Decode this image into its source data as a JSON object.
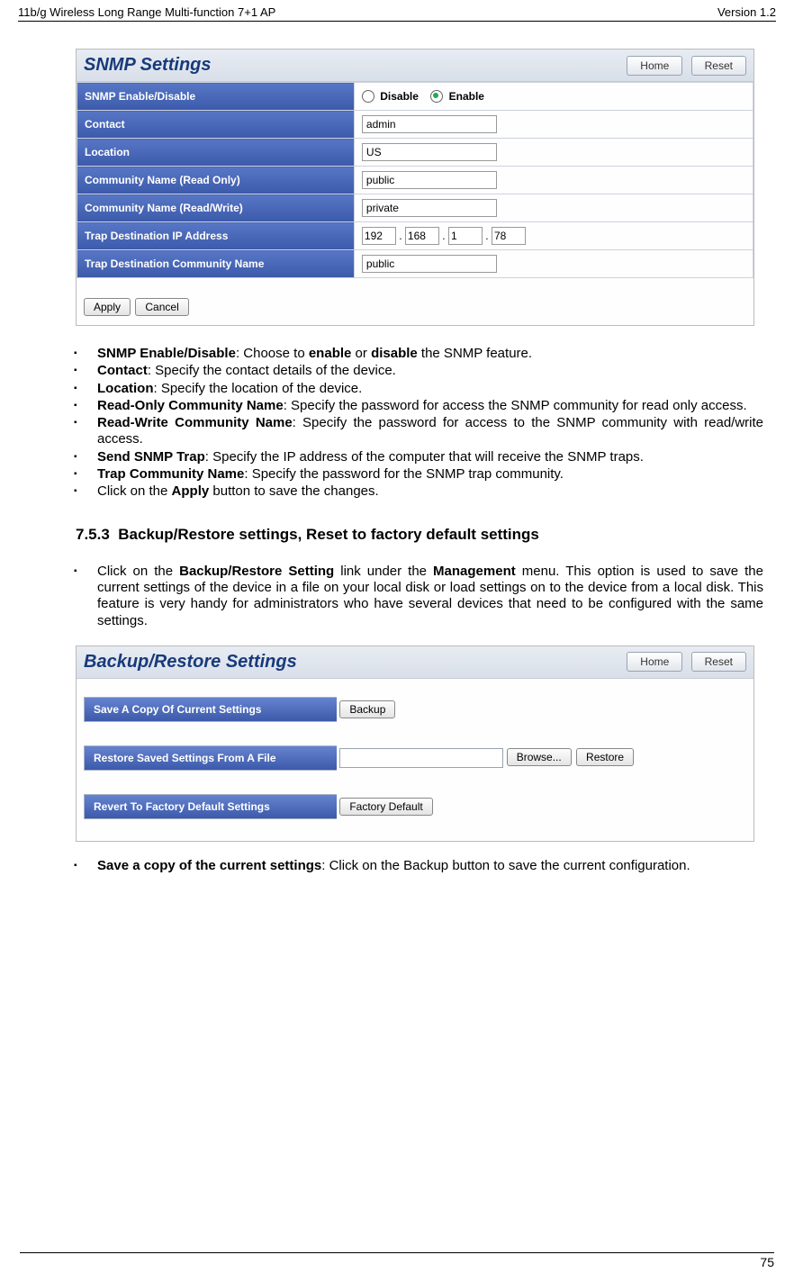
{
  "header": {
    "left": "11b/g Wireless Long Range Multi-function 7+1 AP",
    "right": "Version 1.2"
  },
  "snmp": {
    "title": "SNMP Settings",
    "home": "Home",
    "reset": "Reset",
    "rows": {
      "enable_label": "SNMP Enable/Disable",
      "disable": "Disable",
      "enable": "Enable",
      "contact_label": "Contact",
      "contact_val": "admin",
      "location_label": "Location",
      "location_val": "US",
      "ro_label": "Community Name (Read Only)",
      "ro_val": "public",
      "rw_label": "Community Name (Read/Write)",
      "rw_val": "private",
      "trap_ip_label": "Trap Destination IP Address",
      "ip1": "192",
      "ip2": "168",
      "ip3": "1",
      "ip4": "78",
      "trap_comm_label": "Trap Destination Community Name",
      "trap_comm_val": "public"
    },
    "apply": "Apply",
    "cancel": "Cancel"
  },
  "bullets1": {
    "b1a": "SNMP Enable/Disable",
    "b1b": ": Choose to ",
    "b1c": "enable",
    "b1d": " or ",
    "b1e": "disable",
    "b1f": " the SNMP feature.",
    "b2a": "Contact",
    "b2b": ": Specify the contact details of the device.",
    "b3a": "Location",
    "b3b": ": Specify the location of the device.",
    "b4a": "Read-Only Community Name",
    "b4b": ": Specify the password for access the SNMP community for read only access.",
    "b5a": "Read-Write Community Name",
    "b5b": ": Specify the password for access to the SNMP community with read/write access.",
    "b6a": "Send SNMP Trap",
    "b6b": ": Specify the IP address of the computer that will receive the SNMP traps.",
    "b7a": "Trap Community Name",
    "b7b": ": Specify the password for the SNMP trap community.",
    "b8a": "Click on the ",
    "b8b": "Apply",
    "b8c": " button to save the changes."
  },
  "section": {
    "num": "7.5.3",
    "title": "Backup/Restore settings, Reset to factory default settings"
  },
  "bullets2": {
    "b1a": "Click on the ",
    "b1b": "Backup/Restore Setting",
    "b1c": " link under the ",
    "b1d": "Management",
    "b1e": " menu. This option is used to save the current settings of the device in a file on your local disk or load settings on to the device from a local disk. This feature is very handy for administrators who have several devices that need to be configured with the same settings."
  },
  "backup": {
    "title": "Backup/Restore Settings",
    "home": "Home",
    "reset": "Reset",
    "save_label": "Save A Copy Of Current Settings",
    "backup_btn": "Backup",
    "restore_label": "Restore Saved Settings From A File",
    "browse": "Browse...",
    "restore_btn": "Restore",
    "revert_label": "Revert To Factory Default Settings",
    "factory_btn": "Factory Default"
  },
  "bullets3": {
    "b1a": "Save a copy of the current settings",
    "b1b": ": Click on the Backup button to save the current configuration."
  },
  "footer": {
    "page": "75"
  }
}
